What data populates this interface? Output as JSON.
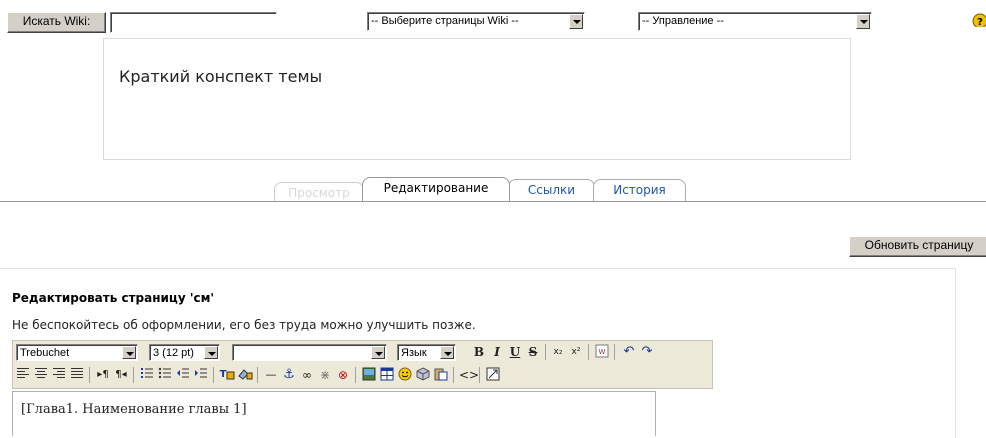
{
  "search": {
    "button_label": "Искать Wiki:",
    "value": ""
  },
  "wiki_pages_select": {
    "selected": "-- Выберите страницы Wiki --"
  },
  "admin_select": {
    "selected": "-- Управление --"
  },
  "summary": {
    "text": "Краткий конспект темы"
  },
  "tabs": [
    {
      "label": "Просмотр",
      "state": "disabled"
    },
    {
      "label": "Редактирование",
      "state": "active"
    },
    {
      "label": "Ссылки",
      "state": "link"
    },
    {
      "label": "История",
      "state": "link"
    }
  ],
  "update_button": {
    "label": "Обновить страницу"
  },
  "edit": {
    "heading": "Редактировать страницу 'см'",
    "hint": "Не беспокойтесь об оформлении, его без труда можно улучшить позже.",
    "font_select": "Trebuchet",
    "size_select": "3 (12 pt)",
    "format_select": "",
    "lang_select": "Язык",
    "content": "[Глава1. Наименование главы 1]"
  }
}
